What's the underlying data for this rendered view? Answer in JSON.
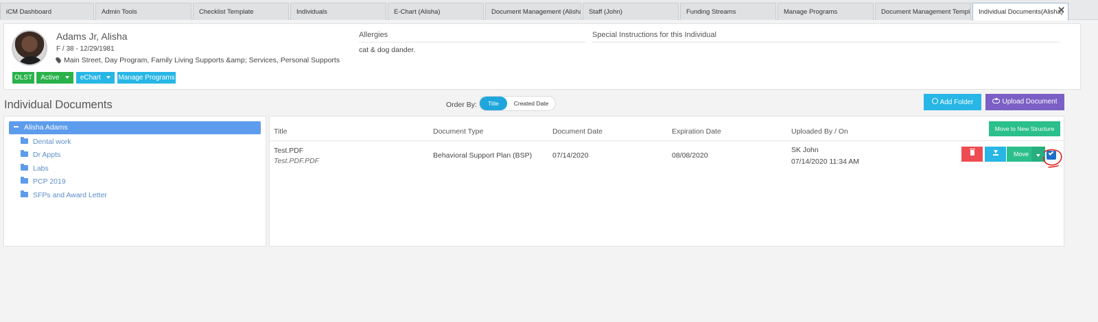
{
  "tabs": [
    {
      "label": "iCM Dashboard"
    },
    {
      "label": "Admin Tools"
    },
    {
      "label": "Checklist Template"
    },
    {
      "label": "Individuals"
    },
    {
      "label": "E-Chart (Alisha)"
    },
    {
      "label": "Document Management (Alisha)"
    },
    {
      "label": "Staff (John)"
    },
    {
      "label": "Funding Streams"
    },
    {
      "label": "Manage Programs"
    },
    {
      "label": "Document Management Template"
    },
    {
      "label": "Individual Documents(Alisha)"
    }
  ],
  "close_glyph": "✕",
  "profile": {
    "name": "Adams Jr, Alisha",
    "demographics": "F  /  38 - 12/29/1981",
    "location": "Main Street, Day Program, Family Living Supports &amp; Services, Personal Supports",
    "badges": {
      "olst": "OLST",
      "status": "Active",
      "echart": "eChart",
      "manage_programs": "Manage Programs"
    }
  },
  "allergies": {
    "title": "Allergies",
    "text": "cat & dog dander."
  },
  "special_instructions": {
    "title": "Special Instructions for this Individual"
  },
  "section_title": "Individual Documents",
  "order_by": {
    "label": "Order By:",
    "options": [
      "Title",
      "Created Date"
    ],
    "selected": "Title"
  },
  "actions": {
    "add_folder": "Add Folder",
    "upload_document": "Upload Document"
  },
  "tree": {
    "root": "Alisha Adams",
    "folders": [
      "Dental work",
      "Dr Appts",
      "Labs",
      "PCP 2019",
      "SFPs and Award Letter"
    ]
  },
  "table": {
    "headers": [
      "Title",
      "Document Type",
      "Document Date",
      "Expiration Date",
      "Uploaded By / On"
    ],
    "move_structure_label": "Move to New Structure",
    "rows": [
      {
        "title": "Test.PDF",
        "filename": "Test.PDF.PDF",
        "type": "Behavioral Support Plan (BSP)",
        "doc_date": "07/14/2020",
        "exp_date": "08/08/2020",
        "uploaded_by": "SK John",
        "uploaded_on": "07/14/2020 11:34 AM",
        "move_label": "Move"
      }
    ]
  },
  "colors": {
    "accent_blue": "#27b6e6",
    "purple": "#7b5fc5",
    "green": "#2bbf8b",
    "red": "#ee4c52",
    "tree_selected": "#5d9cec",
    "annotation_red": "#e0201b"
  }
}
